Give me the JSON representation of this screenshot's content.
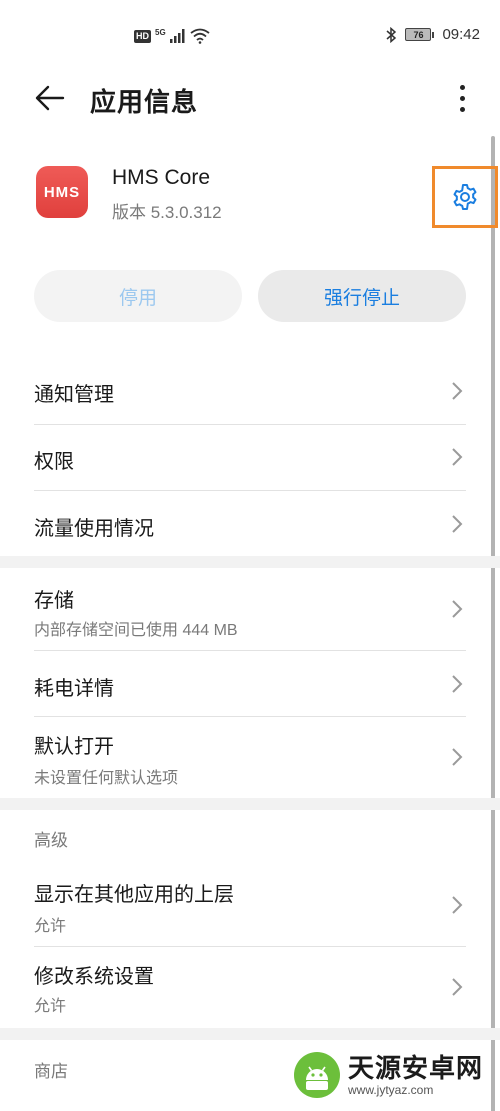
{
  "status_bar": {
    "hd": "HD",
    "network": "5G",
    "battery": "76",
    "time": "09:42"
  },
  "app_bar": {
    "title": "应用信息"
  },
  "app": {
    "name": "HMS Core",
    "version": "版本 5.3.0.312",
    "icon_text": "HMS",
    "icon_color": "#e8484a"
  },
  "actions": {
    "disable_label": "停用",
    "force_stop_label": "强行停止"
  },
  "list": {
    "notifications": "通知管理",
    "permissions": "权限",
    "data_usage": "流量使用情况",
    "storage_title": "存储",
    "storage_sub": "内部存储空间已使用 444 MB",
    "battery_title": "耗电详情",
    "open_default_title": "默认打开",
    "open_default_sub": "未设置任何默认选项",
    "advanced_header": "高级",
    "overlay_title": "显示在其他应用的上层",
    "overlay_sub": "允许",
    "write_settings_title": "修改系统设置",
    "write_settings_sub": "允许",
    "store_header": "商店"
  },
  "watermark": {
    "title": "天源安卓网",
    "url": "www.jytyaz.com"
  },
  "colors": {
    "accent": "#1a7ee0",
    "highlight": "#f08a2c",
    "disabled_text": "#9cc8ef"
  }
}
